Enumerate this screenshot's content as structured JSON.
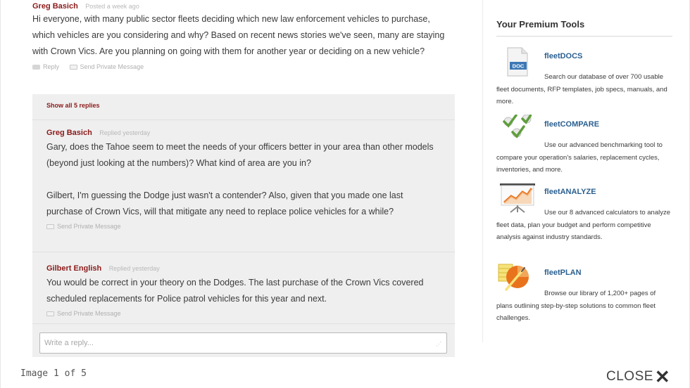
{
  "post": {
    "author": "Greg Basich",
    "meta": "Posted a week ago",
    "body": "Hi everyone, with many public sector fleets deciding which new law enforcement vehicles to purchase, which vehicles are you considering and why? Based on recent news stories we've seen, many are staying with Crown Vics. Are you planning on going with them for another year or deciding on a new vehicle?",
    "reply_label": "Reply",
    "message_label": "Send Private Message"
  },
  "replies": {
    "show_all": "Show all 5 replies",
    "items": [
      {
        "author": "Greg Basich",
        "meta": "Replied yesterday",
        "paragraphs": [
          "Gary, does the Tahoe seem to meet the needs of your officers better in your area than other models (beyond just looking at the numbers)? What kind of area are you in?",
          "Gilbert, I'm guessing the Dodge just wasn't a contender? Also, given that you made one last purchase of Crown Vics, will that mitigate any need to replace police vehicles for a while?"
        ],
        "message_label": "Send Private Message"
      },
      {
        "author": "Gilbert English",
        "meta": "Replied yesterday",
        "paragraphs": [
          "You would be correct in your theory on the Dodges. The last purchase of the Crown Vics covered scheduled replacements for Police patrol vehicles for this year and next."
        ],
        "message_label": "Send Private Message"
      }
    ],
    "input_placeholder": "Write a reply..."
  },
  "sidebar": {
    "title": "Your Premium Tools",
    "tools": [
      {
        "name": "fleetDOCS",
        "icon": "document-icon",
        "icon_text": "DOC",
        "desc": "Search our database of over 700 usable fleet documents, RFP templates, job specs, manuals, and more."
      },
      {
        "name": "fleetCOMPARE",
        "icon": "checkmarks-icon",
        "desc": "Use our advanced benchmarking tool to compare your operation's salaries, replacement cycles, inventories, and more."
      },
      {
        "name": "fleetANALYZE",
        "icon": "chart-easel-icon",
        "desc": "Use our 8 advanced calculators to analyze fleet data, plan your budget and perform competitive analysis against industry standards."
      },
      {
        "name": "fleetPLAN",
        "icon": "pie-chart-icon",
        "desc": "Browse our library of 1,200+ pages of plans outlining step-by-step solutions to common fleet challenges."
      }
    ]
  },
  "footer": {
    "counter": "Image 1 of 5",
    "close_label": "CLOSE"
  },
  "colors": {
    "author": "#8b1a1a",
    "tool_link": "#2a5f8f",
    "reply_bg": "#efefef",
    "accent_orange": "#e8731c",
    "check_green": "#6aa84f"
  }
}
